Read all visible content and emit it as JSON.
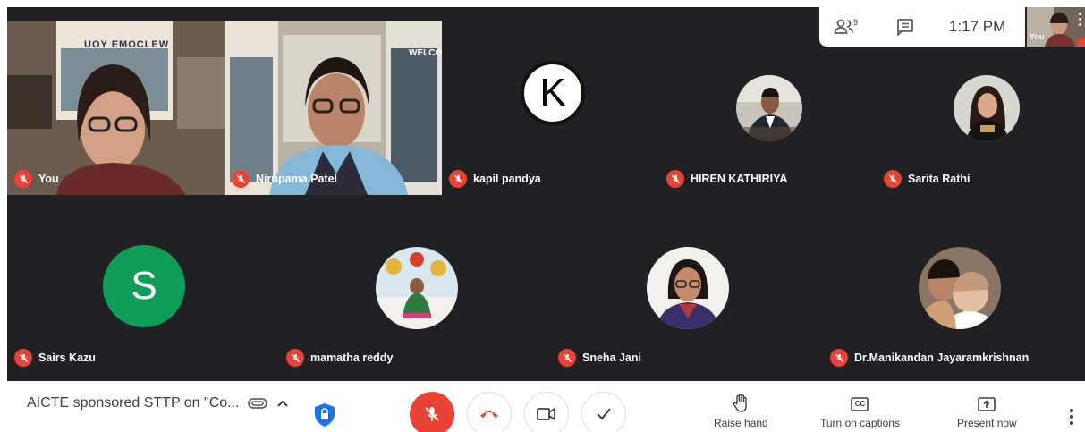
{
  "time": "1:17 PM",
  "self_label": "You",
  "meeting_title": "AICTE sponsored STTP on \"Co...",
  "participant_count_badge": "9",
  "colors": {
    "muted_red": "#ea4335",
    "tile_bg": "#202124",
    "green_avatar": "#0f9d58"
  },
  "participants": [
    {
      "name": "You"
    },
    {
      "name": "Nirupama Patel"
    },
    {
      "name": "kapil pandya",
      "initial": "K"
    },
    {
      "name": "HIREN KATHIRIYA"
    },
    {
      "name": "Sarita Rathi"
    },
    {
      "name": "Sairs Kazu",
      "initial": "S"
    },
    {
      "name": "mamatha reddy"
    },
    {
      "name": "Sneha Jani"
    },
    {
      "name": "Dr.Manikandan Jayaramkrishnan"
    }
  ],
  "banners": {
    "left": "UOY EMOCLEW",
    "right": "WELCO"
  },
  "actions": {
    "raise_hand": "Raise hand",
    "captions": "Turn on captions",
    "present": "Present now"
  },
  "captions_icon_text": "CC"
}
